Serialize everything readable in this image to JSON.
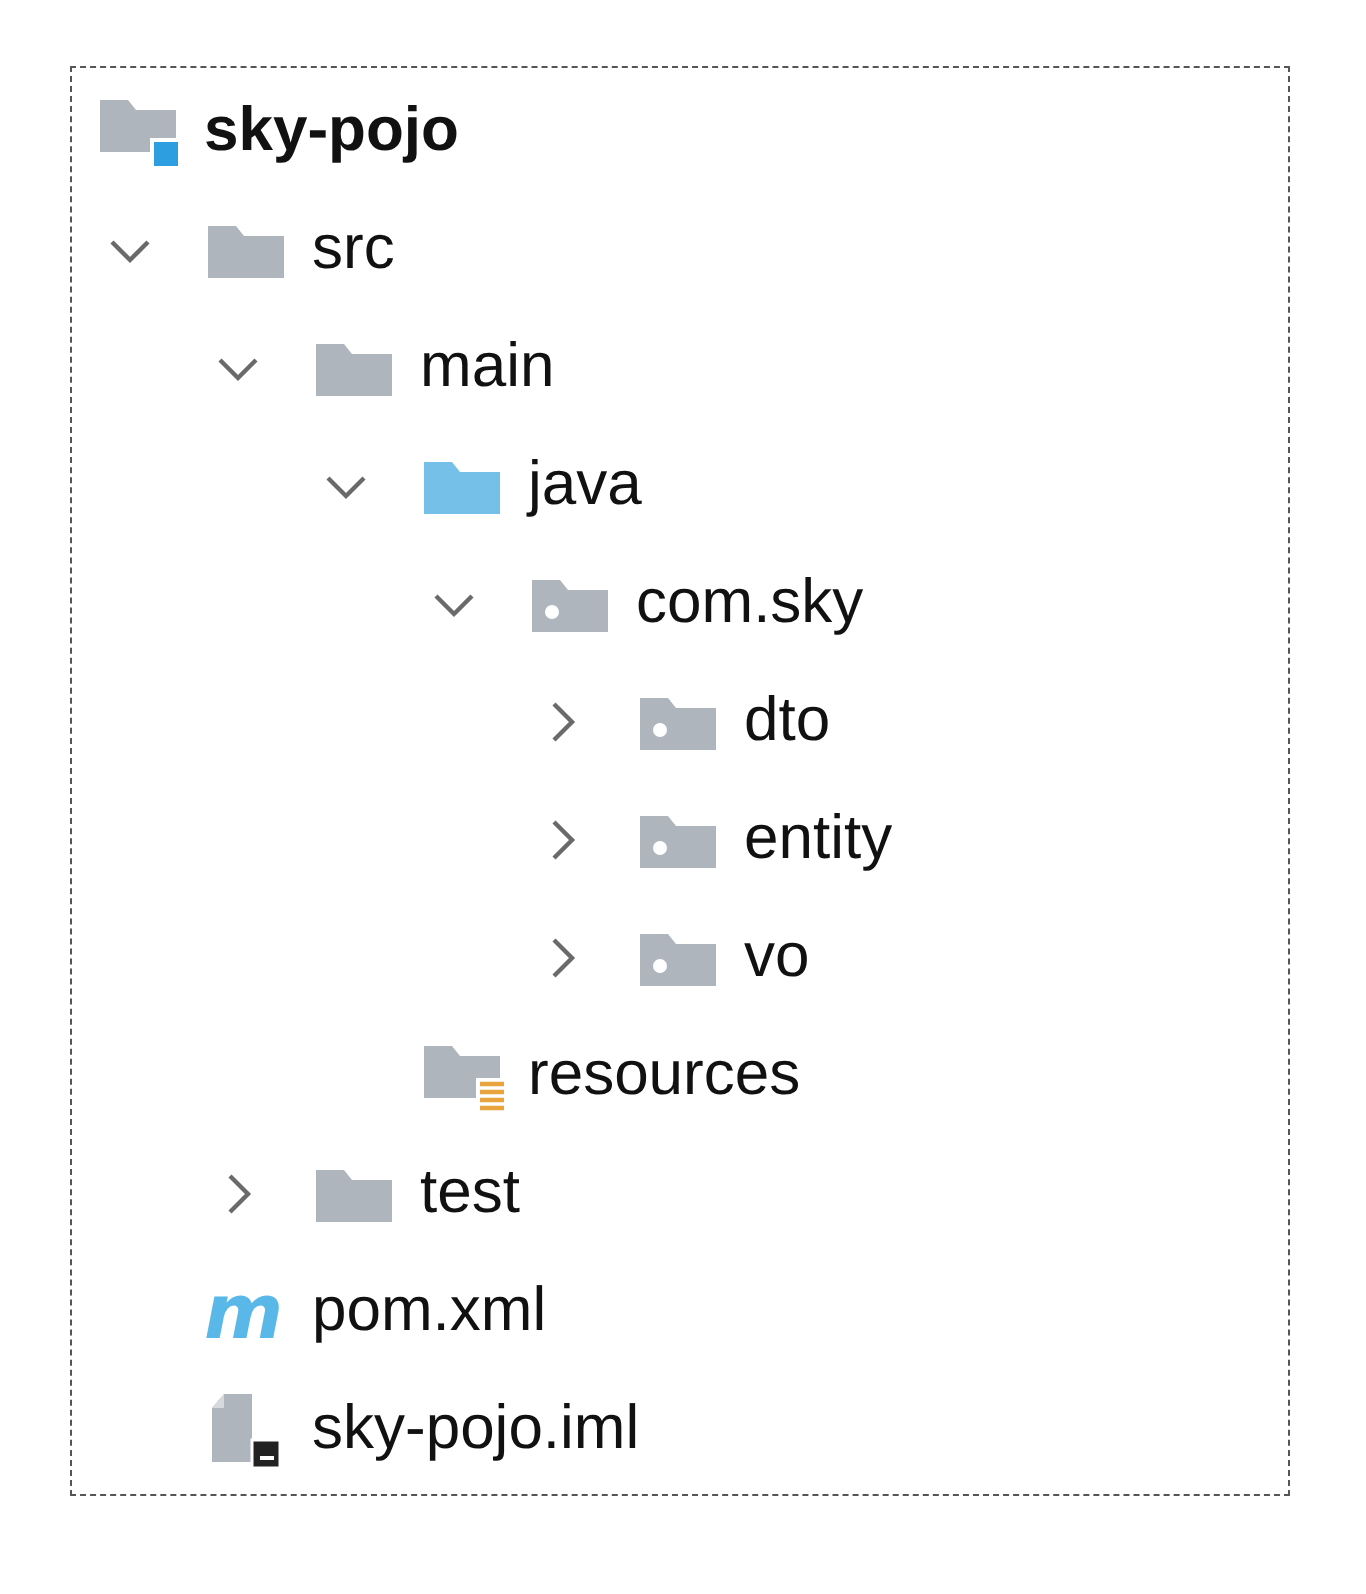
{
  "tree": [
    {
      "label": "sky-pojo",
      "kind": "module",
      "children": [
        {
          "label": "src",
          "kind": "folder",
          "expanded": true,
          "children": [
            {
              "label": "main",
              "kind": "folder",
              "expanded": true,
              "children": [
                {
                  "label": "java",
                  "kind": "source",
                  "expanded": true,
                  "children": [
                    {
                      "label": "com.sky",
                      "kind": "package",
                      "expanded": true,
                      "children": [
                        {
                          "label": "dto",
                          "kind": "package",
                          "expanded": false
                        },
                        {
                          "label": "entity",
                          "kind": "package",
                          "expanded": false
                        },
                        {
                          "label": "vo",
                          "kind": "package",
                          "expanded": false
                        }
                      ]
                    }
                  ]
                },
                {
                  "label": "resources",
                  "kind": "resources"
                }
              ]
            },
            {
              "label": "test",
              "kind": "folder",
              "expanded": false
            }
          ]
        },
        {
          "label": "pom.xml",
          "kind": "maven",
          "glyph": "m"
        },
        {
          "label": "sky-pojo.iml",
          "kind": "iml"
        }
      ]
    }
  ]
}
